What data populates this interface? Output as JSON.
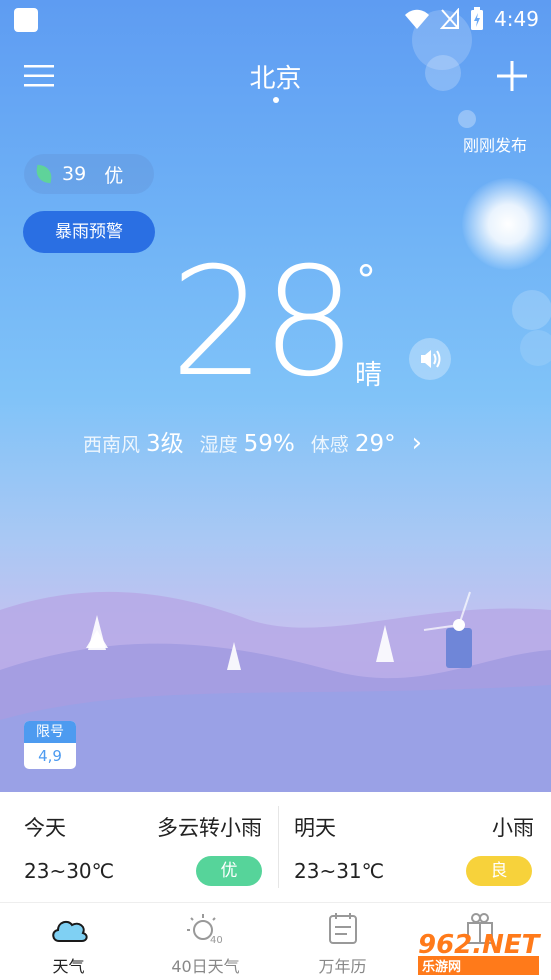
{
  "status_bar": {
    "time": "4:49"
  },
  "header": {
    "city": "北京",
    "updated": "刚刚发布"
  },
  "aqi": {
    "value": "39",
    "level": "优"
  },
  "alert": {
    "label": "暴雨预警"
  },
  "current": {
    "temperature": "28",
    "degree_symbol": "°",
    "condition": "晴",
    "wind_label": "西南风",
    "wind_value": "3级",
    "humidity_label": "湿度",
    "humidity_value": "59%",
    "feels_label": "体感",
    "feels_value": "29°",
    "chevron": "›"
  },
  "traffic_restriction": {
    "title": "限号",
    "numbers": "4,9"
  },
  "forecast": {
    "today": {
      "day": "今天",
      "weather": "多云转小雨",
      "range": "23~30℃",
      "aqi": "优",
      "aqi_color": "#56d49a"
    },
    "tomorrow": {
      "day": "明天",
      "weather": "小雨",
      "range": "23~31℃",
      "aqi": "良",
      "aqi_color": "#f7d23b"
    }
  },
  "tabs": [
    {
      "label": "天气",
      "icon": "cloud-icon",
      "active": true
    },
    {
      "label": "40日天气",
      "icon": "sun-40-icon",
      "active": false
    },
    {
      "label": "万年历",
      "icon": "calendar-icon",
      "active": false
    },
    {
      "label": "",
      "icon": "gift-icon",
      "active": false
    }
  ],
  "watermark": {
    "text": "962.NET",
    "sub": "乐游网"
  },
  "colors": {
    "alert_blue": "#2a6fe3",
    "accent_blue": "#4d9bf0"
  }
}
